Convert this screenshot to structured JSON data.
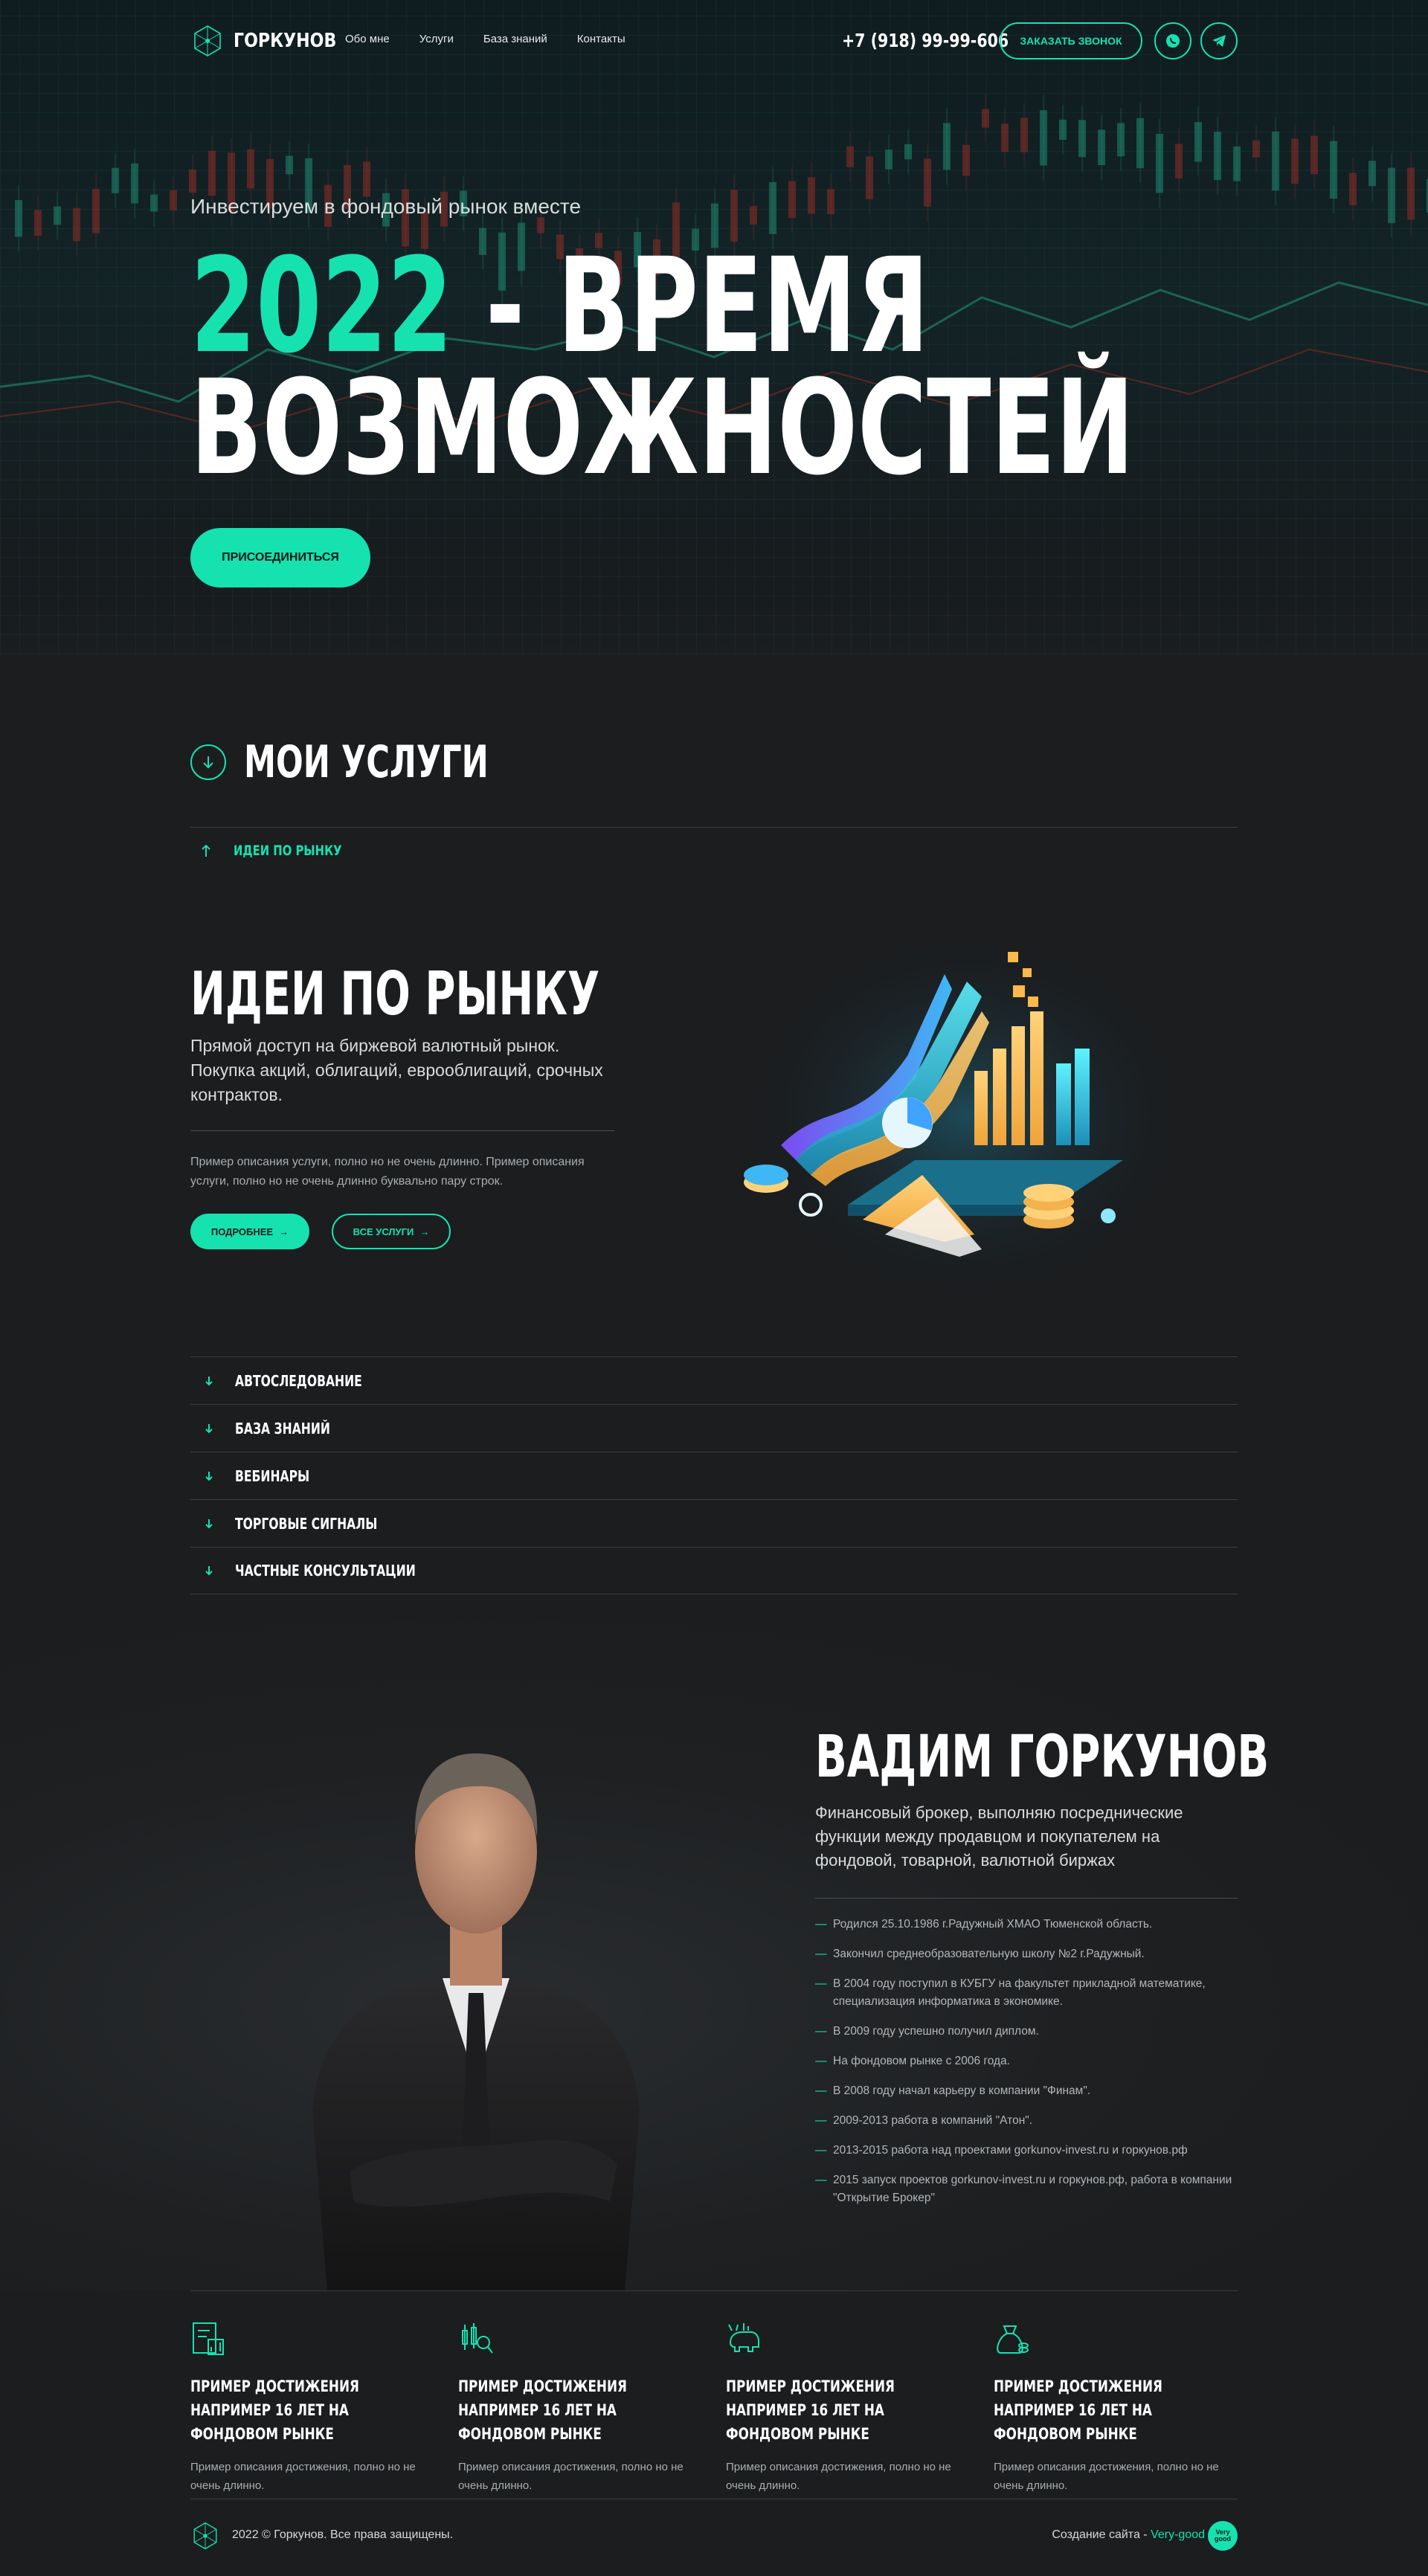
{
  "brand": {
    "name": "ГОРКУНОВ",
    "accent_color": "#16e2b0",
    "background": "#1b1d1f"
  },
  "header": {
    "nav": [
      "Обо мне",
      "Услуги",
      "База знаний",
      "Контакты"
    ],
    "phone": "+7 (918) 99-99-606",
    "call_button": "ЗАКАЗАТЬ ЗВОНОК",
    "socials": [
      "whatsapp-icon",
      "telegram-icon"
    ]
  },
  "hero": {
    "subtitle": "Инвестируем в фондовый рынок вместе",
    "title_accent": "2022",
    "title_line1_rest": " - ВРЕМЯ",
    "title_line2": "ВОЗМОЖНОСТЕЙ",
    "cta": "ПРИСОЕДИНИТЬСЯ"
  },
  "services": {
    "heading": "МОИ УСЛУГИ",
    "open_item": "ИДЕИ ПО РЫНКУ",
    "active": {
      "title": "ИДЕИ ПО РЫНКУ",
      "lead": "Прямой доступ на биржевой валютный рынок. Покупка акций, облигаций, еврооблигаций, срочных контрактов.",
      "description": "Пример описания услуги, полно но не очень длинно. Пример описания услуги, полно но не очень длинно буквально пару строк.",
      "more_button": "ПОДРОБНЕЕ",
      "all_button": "ВСЕ УСЛУГИ"
    },
    "items": [
      "АВТОСЛЕДОВАНИЕ",
      "БАЗА ЗНАНИЙ",
      "ВЕБИНАРЫ",
      "ТОРГОВЫЕ СИГНАЛЫ",
      "ЧАСТНЫЕ КОНСУЛЬТАЦИИ"
    ]
  },
  "about": {
    "name": "ВАДИМ ГОРКУНОВ",
    "lead": "Финансовый брокер, выполняю посреднические функции между продавцом и покупателем на фондовой, товарной, валютной биржах",
    "bio": [
      "Родился 25.10.1986 г.Радужный ХМАО Тюменской область.",
      "Закончил среднеобразовательную школу №2 г.Радужный.",
      "В 2004 году поступил в КУБГУ на факультет прикладной математике, специализация информатика в экономике.",
      "В 2009 году успешно получил диплом.",
      "На фондовом рынке с 2006 года.",
      "В 2008 году начал карьеру в компании \"Финам\".",
      "2009-2013 работа в компаний \"Атон\".",
      "2013-2015 работа над проектами gorkunov-invest.ru и горкунов.рф",
      "2015 запуск проектов gorkunov-invest.ru и горкунов.рф, работа в компании \"Открытие Брокер\""
    ]
  },
  "achievements": [
    {
      "icon": "document-chart-icon",
      "title": "ПРИМЕР ДОСТИЖЕНИЯ НАПРИМЕР 16 ЛЕТ НА ФОНДОВОМ РЫНКЕ",
      "text": "Пример описания достижения, полно но не очень длинно."
    },
    {
      "icon": "candles-search-icon",
      "title": "ПРИМЕР ДОСТИЖЕНИЯ НАПРИМЕР 16 ЛЕТ НА ФОНДОВОМ РЫНКЕ",
      "text": "Пример описания достижения, полно но не очень длинно."
    },
    {
      "icon": "bull-chart-icon",
      "title": "ПРИМЕР ДОСТИЖЕНИЯ НАПРИМЕР 16 ЛЕТ НА ФОНДОВОМ РЫНКЕ",
      "text": "Пример описания достижения, полно но не очень длинно."
    },
    {
      "icon": "money-bag-icon",
      "title": "ПРИМЕР ДОСТИЖЕНИЯ НАПРИМЕР 16 ЛЕТ НА ФОНДОВОМ РЫНКЕ",
      "text": "Пример описания достижения, полно но не очень длинно."
    }
  ],
  "footer": {
    "copyright": "2022 © Горкунов. Все права защищены.",
    "made_by_label": "Создание сайта - ",
    "made_by_link": "Very-good",
    "badge": "Very good"
  }
}
